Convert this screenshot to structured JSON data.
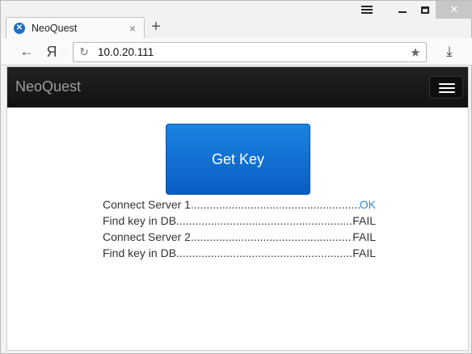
{
  "browser": {
    "tab": {
      "title": "NeoQuest",
      "favicon": "neoquest-favicon-icon",
      "close_glyph": "×"
    },
    "new_tab_glyph": "+",
    "address": {
      "url": "10.0.20.111",
      "ya_label": "Я"
    }
  },
  "app": {
    "brand": "NeoQuest",
    "get_key_label": "Get Key",
    "results": [
      {
        "label": "Connect Server 1 ",
        "status": "OK"
      },
      {
        "label": "Find key in DB",
        "status": "FAIL"
      },
      {
        "label": "Connect Server 2 ",
        "status": "FAIL"
      },
      {
        "label": "Find key in DB",
        "status": "FAIL"
      }
    ],
    "colors": {
      "navbar": "#111111",
      "button": "#0a5dc2",
      "ok": "#3489c3",
      "fail": "#333333"
    }
  }
}
